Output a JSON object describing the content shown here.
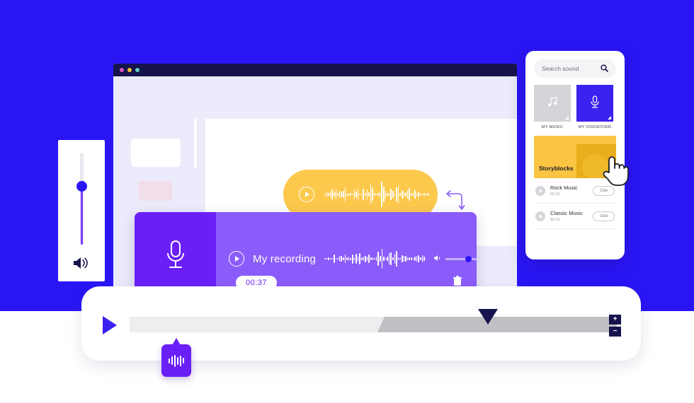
{
  "colors": {
    "background_blue": "#2a16f5",
    "navy": "#16134d",
    "purple_dark": "#6a1ff7",
    "purple_light": "#8b5cf9",
    "yellow": "#fcc94d",
    "accent_blue": "#3b22f0"
  },
  "browser": {
    "titlebar_dots": [
      "pink-dot",
      "yellow-dot",
      "teal-dot"
    ]
  },
  "volume_panel": {
    "speaker_icon": "speaker-volume-icon",
    "slider_value": 62
  },
  "yellow_clip": {
    "play_icon": "play-circle-icon",
    "waveform_icon": "audio-waveform"
  },
  "recording": {
    "mic_icon": "microphone-icon",
    "play_icon": "play-circle-icon",
    "title": "My recording",
    "duration": "00:37",
    "volume_icon": "speaker-icon",
    "delete_icon": "trash-icon",
    "volume_value": 52
  },
  "timeline": {
    "play_icon": "play-icon",
    "zoom_in_label": "+",
    "zoom_out_label": "−",
    "progress_percent": 49,
    "playhead_percent": 72,
    "waveform_badge_icon": "audio-waveform-icon"
  },
  "sound_panel": {
    "search": {
      "placeholder": "Search sound",
      "icon": "search-icon"
    },
    "tiles": [
      {
        "label": "MY MUSIC",
        "icon": "music-note-icon",
        "style": "gray"
      },
      {
        "label": "MY VOICEOVER",
        "icon": "microphone-icon",
        "style": "blue"
      }
    ],
    "promo": {
      "label": "Storyblocks",
      "cursor": "pointing-hand-cursor"
    },
    "tracks": [
      {
        "name": "Rock Music",
        "duration": "02:11",
        "action": "Use",
        "play_icon": "play-circle-icon"
      },
      {
        "name": "Classic Music",
        "duration": "02:11",
        "action": "Use",
        "play_icon": "play-circle-icon"
      }
    ]
  }
}
